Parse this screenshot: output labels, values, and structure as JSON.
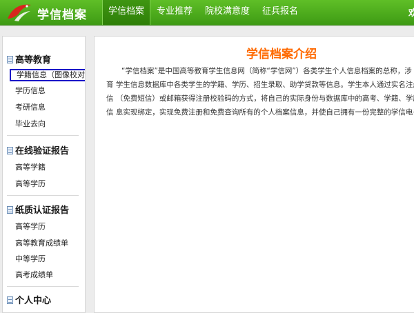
{
  "colors": {
    "topbar": "#4fae1d",
    "title": "#ff6a00",
    "highlight_border": "#1a17c8"
  },
  "brand": {
    "name": "学信档案",
    "logo_icon": "red-bird-logo-icon"
  },
  "nav": {
    "items": [
      {
        "label": "学信档案",
        "active": true
      },
      {
        "label": "专业推荐",
        "active": false
      },
      {
        "label": "院校满意度",
        "active": false
      },
      {
        "label": "征兵报名",
        "active": false
      }
    ],
    "clipped_right_text": "欢"
  },
  "sidebar": {
    "sections": [
      {
        "title": "高等教育",
        "icon": "document-icon",
        "items": [
          {
            "label": "学籍信息（图像校对）",
            "highlighted": true
          },
          {
            "label": "学历信息",
            "highlighted": false
          },
          {
            "label": "考研信息",
            "highlighted": false
          },
          {
            "label": "毕业去向",
            "highlighted": false
          }
        ]
      },
      {
        "title": "在线验证报告",
        "icon": "document-icon",
        "items": [
          {
            "label": "高等学籍",
            "highlighted": false
          },
          {
            "label": "高等学历",
            "highlighted": false
          }
        ]
      },
      {
        "title": "纸质认证报告",
        "icon": "document-icon",
        "items": [
          {
            "label": "高等学历",
            "highlighted": false
          },
          {
            "label": "高等教育成绩单",
            "highlighted": false
          },
          {
            "label": "中等学历",
            "highlighted": false
          },
          {
            "label": "高考成绩单",
            "highlighted": false
          }
        ]
      },
      {
        "title": "个人中心",
        "icon": "document-icon",
        "items": []
      }
    ]
  },
  "main": {
    "title": "学信档案介绍",
    "paragraph_lines": [
      "“学信档案”是中国高等教育学生信息网（简称“学信网”）各类学生个人信息档案的总称，涉",
      "育 学生信息数据库中各类学生的学籍、学历、招生录取、助学贷款等信息。学生本人通过实名注册",
      "信 （免费短信）或邮箱获得注册校验码的方式，将自己的实际身份与数据库中的高考、学籍、学历",
      "信 息实现绑定，实现免费注册和免费查询所有的个人档案信息，并使自己拥有一份完整的学信电子档"
    ]
  }
}
